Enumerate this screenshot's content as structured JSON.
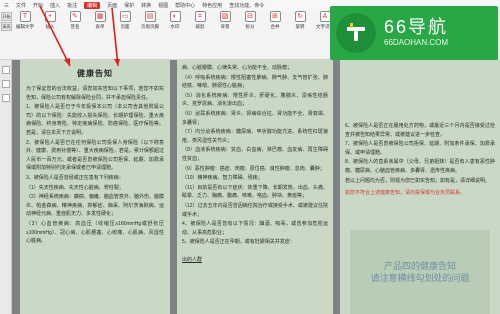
{
  "ribbon": {
    "tabs": [
      "三",
      "文件",
      "开始",
      "插入",
      "批注",
      "编辑",
      "页面",
      "保护",
      "转换",
      "视图",
      "帮助中心",
      "特色应用",
      "查找功能、命令"
    ],
    "active_tab_index": 5,
    "left_buttons": [
      "开始",
      "高亮"
    ],
    "tools": [
      {
        "label": "编辑文字",
        "icon": "T"
      },
      {
        "label": "插入",
        "icon": "+"
      },
      {
        "label": "签名",
        "icon": "✎"
      },
      {
        "label": "表单",
        "icon": "▦"
      },
      {
        "label": "页面",
        "icon": "▭"
      },
      {
        "label": "页眉页脚",
        "icon": "▤"
      },
      {
        "label": "水印",
        "icon": "◐"
      },
      {
        "label": "裁剪",
        "icon": "⌗"
      },
      {
        "label": "背景",
        "icon": "▧"
      },
      {
        "label": "拆分",
        "icon": "⊟"
      },
      {
        "label": "合并",
        "icon": "⊞"
      },
      {
        "label": "旋转",
        "icon": "↻"
      },
      {
        "label": "文字识别",
        "icon": "A"
      },
      {
        "label": "插入页眉",
        "icon": "≡"
      },
      {
        "label": "插入页码",
        "icon": "#"
      }
    ]
  },
  "page1": {
    "title": "健康告知",
    "paragraphs": [
      "为了保证您的合法权益，请您如实告知以下事项，若您不如实告知，保险公司有权解除保险合同，并不承担保险责任。",
      "1、被保险人是否已于今年投保本公司（本公司含其他附属公司）的以下保险：失能收入损失保险、长期护理保险、重大疾病保险、终身寿险、特定疾病保险、防癌保险、医疗保险等。若是，请在本页下方说明。",
      "2、被保险人是否已在任何保险公司投保人身保险（以下称意外、健康、费用补偿等）、重大疾病保险，若是，累计保额超过人民币一百万元，或者是否曾被保险公司拒保、延期、加费承保或附加特别约定承保或者已申请理赔。",
      "3、被保险人是否曾经或正在患有下列疾病：",
      "（1）先天性疾病、先天性心脏病、脊柱裂；",
      "（2）神经系统疾病：癫痫、偏瘫、脑血管意外、脑外伤、脑膜炎、帕金森病、精神疾病、抑郁症、痴呆、阿尔茨海默病、运动神经元病、重症肌无力、多发性硬化；",
      "（3）心血管疾病：高血压（收缩压≥160mmHg或舒张压≥100mmHg）、冠心病、心肌梗塞、心绞痛、心肌病、风湿性心脏病。"
    ]
  },
  "page2": {
    "paragraphs": [
      "病、心脏瓣膜、心律失常、心功能不全、动脉瘤；",
      "（4）呼吸系统疾病：慢性阻塞性肺病、肺气肿、支气管扩张、肺结核、哮喘、肺源性心脏病；",
      "（5）消化系统疾病：慢性肝炎、肝硬化、胰腺炎、溃疡性结肠炎、克罗恩病、消化道出血；",
      "（6）泌尿系统疾病：肾炎、肾病综合征、肾功能不全、肾衰竭、多囊肾；",
      "（7）内分泌系统疾病：糖尿病、甲状腺功能亢进、系统性红斑狼疮、类风湿性关节炎；",
      "（8）血液系统疾病：贫血、白血病、淋巴瘤、血友病、再生障碍性贫血；",
      "（9）恶性肿瘤：癌症、肉瘤、原位癌、良性肿瘤、息肉、囊肿；",
      "（10）精神疾病、智力障碍、残疾；",
      "（11）目前是否有以下症状：体重下降、长期发热、出血、头痛、眩晕、乏力、胸痛、腹痛、咳嗽、咯血、肿块、黄疸等；",
      "（12）过去五年内是否曾因病住院治疗或接受手术、或被建议住院或手术；",
      "4、被保险人是否曾有以下情况：酗酒、吸毒，或曾参加危险运动、从事高危职业；",
      "5、被保险人是否正在孕期，或有妊娠相关并发症："
    ],
    "underlined_fragment": "出的人群"
  },
  "page3": {
    "paragraphs": [
      "6、被保险人是否正在服用处方药物，或最近三个月内是否接受过检查并被告知结果异常、或被建议进一步检查。",
      "7、被保险人是否曾被保险公司拒保、延期、附加条件承保、加费承保、或申请理赔。",
      "8、被保险人的直系亲属中（父母、兄弟姐妹）是否有人患有恶性肿瘤、糖尿病、心脑血管疾病、多囊肾、遗传性疾病。",
      "若以上问题均为否，则视为您已如实告知；如有是，请详细说明。"
    ],
    "red_note": "如您不符合上述健康告知，请勿投保或与业务员联系。",
    "callout_line1": "产品四的健康告知",
    "callout_line2": "请注意横线勾划处的问题"
  },
  "watermark": {
    "title": "66导航",
    "url": "66DAOHAN.COM"
  },
  "colors": {
    "page_bg": "#c9d9c5",
    "accent_red": "#d9302c",
    "watermark_green": "#28a745"
  }
}
